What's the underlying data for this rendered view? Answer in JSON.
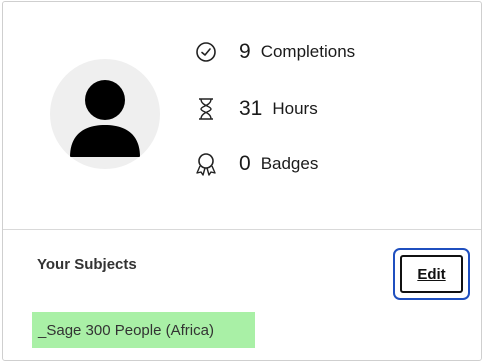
{
  "stats": [
    {
      "icon": "check-circle-icon",
      "value": "9",
      "label": "Completions"
    },
    {
      "icon": "hourglass-icon",
      "value": "31",
      "label": "Hours"
    },
    {
      "icon": "badge-ribbon-icon",
      "value": "0",
      "label": "Badges"
    }
  ],
  "subjects": {
    "title": "Your Subjects",
    "edit_label": "Edit",
    "items": [
      "_Sage 300 People (Africa)"
    ]
  },
  "colors": {
    "subject_highlight": "#a9f0a6",
    "focus_ring": "#1f4fbf",
    "avatar_bg": "#efefef"
  }
}
